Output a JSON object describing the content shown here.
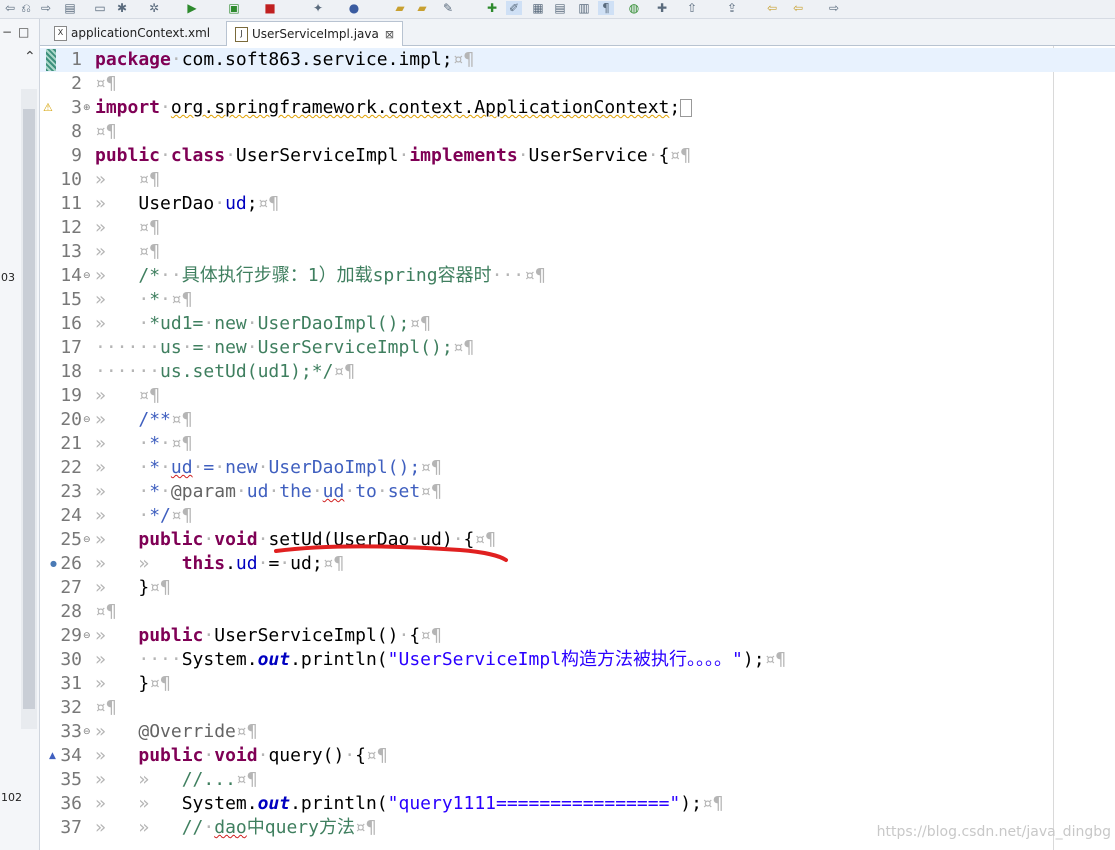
{
  "tabs": [
    {
      "label": "applicationContext.xml",
      "icon": "xml-file-icon",
      "active": false
    },
    {
      "label": "UserServiceImpl.java",
      "icon": "java-file-icon",
      "active": true,
      "close": "⊠"
    }
  ],
  "left_panel": {
    "label_a": "03",
    "label_b": "102"
  },
  "watermark": "https://blog.csdn.net/java_dingbg",
  "lines": [
    {
      "n": "1",
      "current": true,
      "tokens": [
        {
          "t": "package",
          "c": "kw"
        },
        {
          "t": "·",
          "c": "ws"
        },
        {
          "t": "com.soft863.service.impl;",
          "c": ""
        },
        {
          "t": "¤¶",
          "c": "ws"
        }
      ]
    },
    {
      "n": "2",
      "tokens": [
        {
          "t": "¤¶",
          "c": "ws"
        }
      ]
    },
    {
      "n": "3",
      "fold": "⊕",
      "marker": "warning-icon",
      "tokens": [
        {
          "t": "import",
          "c": "kw"
        },
        {
          "t": "·",
          "c": "ws"
        },
        {
          "t": "org.springframework.context.ApplicationContext",
          "c": "sq"
        },
        {
          "t": ";",
          "c": ""
        },
        {
          "t": " ",
          "c": "box"
        }
      ]
    },
    {
      "n": "8",
      "tokens": [
        {
          "t": "¤¶",
          "c": "ws"
        }
      ]
    },
    {
      "n": "9",
      "tokens": [
        {
          "t": "public",
          "c": "kw"
        },
        {
          "t": "·",
          "c": "ws"
        },
        {
          "t": "class",
          "c": "kw"
        },
        {
          "t": "·",
          "c": "ws"
        },
        {
          "t": "UserServiceImpl",
          "c": ""
        },
        {
          "t": "·",
          "c": "ws"
        },
        {
          "t": "implements",
          "c": "kw"
        },
        {
          "t": "·",
          "c": "ws"
        },
        {
          "t": "UserService",
          "c": ""
        },
        {
          "t": "·",
          "c": "ws"
        },
        {
          "t": "{",
          "c": ""
        },
        {
          "t": "¤¶",
          "c": "ws"
        }
      ]
    },
    {
      "n": "10",
      "tokens": [
        {
          "t": "»   ",
          "c": "ws"
        },
        {
          "t": "¤¶",
          "c": "ws"
        }
      ]
    },
    {
      "n": "11",
      "tokens": [
        {
          "t": "»   ",
          "c": "ws"
        },
        {
          "t": "UserDao",
          "c": ""
        },
        {
          "t": "·",
          "c": "ws"
        },
        {
          "t": "ud",
          "c": "fd"
        },
        {
          "t": ";",
          "c": ""
        },
        {
          "t": "¤¶",
          "c": "ws"
        }
      ]
    },
    {
      "n": "12",
      "tokens": [
        {
          "t": "»   ",
          "c": "ws"
        },
        {
          "t": "¤¶",
          "c": "ws"
        }
      ]
    },
    {
      "n": "13",
      "tokens": [
        {
          "t": "»   ",
          "c": "ws"
        },
        {
          "t": "¤¶",
          "c": "ws"
        }
      ]
    },
    {
      "n": "14",
      "fold": "⊖",
      "tokens": [
        {
          "t": "»   ",
          "c": "ws"
        },
        {
          "t": "/*",
          "c": "cm"
        },
        {
          "t": "··",
          "c": "ws"
        },
        {
          "t": "具体执行步骤：1）加载spring容器时",
          "c": "cm"
        },
        {
          "t": "···",
          "c": "ws"
        },
        {
          "t": "¤¶",
          "c": "ws"
        }
      ]
    },
    {
      "n": "15",
      "tokens": [
        {
          "t": "»   ",
          "c": "ws"
        },
        {
          "t": "·",
          "c": "ws"
        },
        {
          "t": "*",
          "c": "cm"
        },
        {
          "t": "·",
          "c": "ws"
        },
        {
          "t": "¤¶",
          "c": "ws"
        }
      ]
    },
    {
      "n": "16",
      "tokens": [
        {
          "t": "»   ",
          "c": "ws"
        },
        {
          "t": "·",
          "c": "ws"
        },
        {
          "t": "*ud1=",
          "c": "cm"
        },
        {
          "t": "·",
          "c": "ws"
        },
        {
          "t": "new",
          "c": "cm"
        },
        {
          "t": "·",
          "c": "ws"
        },
        {
          "t": "UserDaoImpl();",
          "c": "cm"
        },
        {
          "t": "¤¶",
          "c": "ws"
        }
      ]
    },
    {
      "n": "17",
      "tokens": [
        {
          "t": "······",
          "c": "ws"
        },
        {
          "t": "us",
          "c": "cm"
        },
        {
          "t": "·",
          "c": "ws"
        },
        {
          "t": "=",
          "c": "cm"
        },
        {
          "t": "·",
          "c": "ws"
        },
        {
          "t": "new",
          "c": "cm"
        },
        {
          "t": "·",
          "c": "ws"
        },
        {
          "t": "UserServiceImpl();",
          "c": "cm"
        },
        {
          "t": "¤¶",
          "c": "ws"
        }
      ]
    },
    {
      "n": "18",
      "tokens": [
        {
          "t": "······",
          "c": "ws"
        },
        {
          "t": "us.setUd(ud1);*/",
          "c": "cm"
        },
        {
          "t": "¤¶",
          "c": "ws"
        }
      ]
    },
    {
      "n": "19",
      "tokens": [
        {
          "t": "»   ",
          "c": "ws"
        },
        {
          "t": "¤¶",
          "c": "ws"
        }
      ]
    },
    {
      "n": "20",
      "fold": "⊖",
      "tokens": [
        {
          "t": "»   ",
          "c": "ws"
        },
        {
          "t": "/**",
          "c": "jd"
        },
        {
          "t": "¤¶",
          "c": "ws"
        }
      ]
    },
    {
      "n": "21",
      "tokens": [
        {
          "t": "»   ",
          "c": "ws"
        },
        {
          "t": "·",
          "c": "ws"
        },
        {
          "t": "*",
          "c": "jd"
        },
        {
          "t": "·",
          "c": "ws"
        },
        {
          "t": "¤¶",
          "c": "ws"
        }
      ]
    },
    {
      "n": "22",
      "tokens": [
        {
          "t": "»   ",
          "c": "ws"
        },
        {
          "t": "·",
          "c": "ws"
        },
        {
          "t": "*",
          "c": "jd"
        },
        {
          "t": "·",
          "c": "ws"
        },
        {
          "t": "ud",
          "c": "jd sqr"
        },
        {
          "t": "·",
          "c": "ws"
        },
        {
          "t": "=",
          "c": "jd"
        },
        {
          "t": "·",
          "c": "ws"
        },
        {
          "t": "new",
          "c": "jd"
        },
        {
          "t": "·",
          "c": "ws"
        },
        {
          "t": "UserDaoImpl();",
          "c": "jd"
        },
        {
          "t": "¤¶",
          "c": "ws"
        }
      ]
    },
    {
      "n": "23",
      "tokens": [
        {
          "t": "»   ",
          "c": "ws"
        },
        {
          "t": "·",
          "c": "ws"
        },
        {
          "t": "*",
          "c": "jd"
        },
        {
          "t": "·",
          "c": "ws"
        },
        {
          "t": "@param",
          "c": "an"
        },
        {
          "t": "·",
          "c": "ws"
        },
        {
          "t": "ud",
          "c": "jd"
        },
        {
          "t": "·",
          "c": "ws"
        },
        {
          "t": "the",
          "c": "jd"
        },
        {
          "t": "·",
          "c": "ws"
        },
        {
          "t": "ud",
          "c": "jd sqr"
        },
        {
          "t": "·",
          "c": "ws"
        },
        {
          "t": "to",
          "c": "jd"
        },
        {
          "t": "·",
          "c": "ws"
        },
        {
          "t": "set",
          "c": "jd"
        },
        {
          "t": "¤¶",
          "c": "ws"
        }
      ]
    },
    {
      "n": "24",
      "tokens": [
        {
          "t": "»   ",
          "c": "ws"
        },
        {
          "t": "·",
          "c": "ws"
        },
        {
          "t": "*/",
          "c": "jd"
        },
        {
          "t": "¤¶",
          "c": "ws"
        }
      ]
    },
    {
      "n": "25",
      "fold": "⊖",
      "tokens": [
        {
          "t": "»   ",
          "c": "ws"
        },
        {
          "t": "public",
          "c": "kw"
        },
        {
          "t": "·",
          "c": "ws"
        },
        {
          "t": "void",
          "c": "kw"
        },
        {
          "t": "·",
          "c": "ws"
        },
        {
          "t": "setUd(UserDao",
          "c": ""
        },
        {
          "t": "·",
          "c": "ws"
        },
        {
          "t": "ud)",
          "c": ""
        },
        {
          "t": "·",
          "c": "ws"
        },
        {
          "t": "{",
          "c": ""
        },
        {
          "t": "¤¶",
          "c": "ws"
        }
      ]
    },
    {
      "n": "26",
      "dot": true,
      "tokens": [
        {
          "t": "»   ",
          "c": "ws"
        },
        {
          "t": "»   ",
          "c": "ws"
        },
        {
          "t": "this",
          "c": "kw"
        },
        {
          "t": ".",
          "c": ""
        },
        {
          "t": "ud",
          "c": "fd"
        },
        {
          "t": "·",
          "c": "ws"
        },
        {
          "t": "=",
          "c": ""
        },
        {
          "t": "·",
          "c": "ws"
        },
        {
          "t": "ud;",
          "c": ""
        },
        {
          "t": "¤¶",
          "c": "ws"
        }
      ]
    },
    {
      "n": "27",
      "tokens": [
        {
          "t": "»   ",
          "c": "ws"
        },
        {
          "t": "}",
          "c": ""
        },
        {
          "t": "¤¶",
          "c": "ws"
        }
      ]
    },
    {
      "n": "28",
      "tokens": [
        {
          "t": "¤¶",
          "c": "ws"
        }
      ]
    },
    {
      "n": "29",
      "fold": "⊖",
      "tokens": [
        {
          "t": "»   ",
          "c": "ws"
        },
        {
          "t": "public",
          "c": "kw"
        },
        {
          "t": "·",
          "c": "ws"
        },
        {
          "t": "UserServiceImpl()",
          "c": ""
        },
        {
          "t": "·",
          "c": "ws"
        },
        {
          "t": "{",
          "c": ""
        },
        {
          "t": "¤¶",
          "c": "ws"
        }
      ]
    },
    {
      "n": "30",
      "tokens": [
        {
          "t": "»   ",
          "c": "ws"
        },
        {
          "t": "····",
          "c": "ws"
        },
        {
          "t": "System.",
          "c": ""
        },
        {
          "t": "out",
          "c": "sf"
        },
        {
          "t": ".println(",
          "c": ""
        },
        {
          "t": "\"UserServiceImpl构造方法被执行。。。。\"",
          "c": "st"
        },
        {
          "t": ");",
          "c": ""
        },
        {
          "t": "¤¶",
          "c": "ws"
        }
      ]
    },
    {
      "n": "31",
      "tokens": [
        {
          "t": "»   ",
          "c": "ws"
        },
        {
          "t": "}",
          "c": ""
        },
        {
          "t": "¤¶",
          "c": "ws"
        }
      ]
    },
    {
      "n": "32",
      "tokens": [
        {
          "t": "¤¶",
          "c": "ws"
        }
      ]
    },
    {
      "n": "33",
      "fold": "⊖",
      "tokens": [
        {
          "t": "»   ",
          "c": "ws"
        },
        {
          "t": "@Override",
          "c": "an"
        },
        {
          "t": "¤¶",
          "c": "ws"
        }
      ]
    },
    {
      "n": "34",
      "marker": "override-triangle-icon",
      "tokens": [
        {
          "t": "»   ",
          "c": "ws"
        },
        {
          "t": "public",
          "c": "kw"
        },
        {
          "t": "·",
          "c": "ws"
        },
        {
          "t": "void",
          "c": "kw"
        },
        {
          "t": "·",
          "c": "ws"
        },
        {
          "t": "query()",
          "c": ""
        },
        {
          "t": "·",
          "c": "ws"
        },
        {
          "t": "{",
          "c": ""
        },
        {
          "t": "¤¶",
          "c": "ws"
        }
      ]
    },
    {
      "n": "35",
      "tokens": [
        {
          "t": "»   ",
          "c": "ws"
        },
        {
          "t": "»   ",
          "c": "ws"
        },
        {
          "t": "//...",
          "c": "cm"
        },
        {
          "t": "¤¶",
          "c": "ws"
        }
      ]
    },
    {
      "n": "36",
      "tokens": [
        {
          "t": "»   ",
          "c": "ws"
        },
        {
          "t": "»   ",
          "c": "ws"
        },
        {
          "t": "System.",
          "c": ""
        },
        {
          "t": "out",
          "c": "sf"
        },
        {
          "t": ".println(",
          "c": ""
        },
        {
          "t": "\"query1111================\"",
          "c": "st"
        },
        {
          "t": ");",
          "c": ""
        },
        {
          "t": "¤¶",
          "c": "ws"
        }
      ]
    },
    {
      "n": "37",
      "tokens": [
        {
          "t": "»   ",
          "c": "ws"
        },
        {
          "t": "»   ",
          "c": "ws"
        },
        {
          "t": "//",
          "c": "cm"
        },
        {
          "t": "·",
          "c": "ws"
        },
        {
          "t": "dao",
          "c": "cm sqr"
        },
        {
          "t": "中query方法",
          "c": "cm"
        },
        {
          "t": "¤¶",
          "c": "ws"
        }
      ]
    }
  ]
}
